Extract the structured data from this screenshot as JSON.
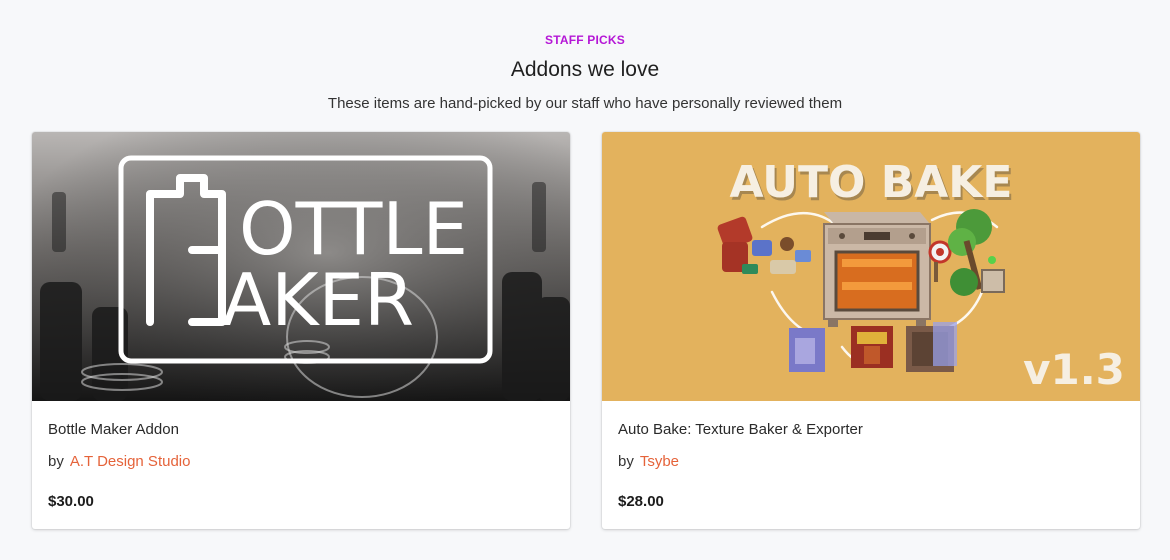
{
  "section": {
    "eyebrow": "STAFF PICKS",
    "title": "Addons we love",
    "subtitle": "These items are hand-picked by our staff who have personally reviewed them"
  },
  "colors": {
    "eyebrow": "#b517d6",
    "author_link": "#e5633a",
    "autobake_bg": "#e3b25d"
  },
  "cards": [
    {
      "name": "Bottle Maker Addon",
      "by_label": "by",
      "author": "A.T Design Studio",
      "price": "$30.00",
      "thumb_text_line1": "OTTLE",
      "thumb_text_line2": "AKER"
    },
    {
      "name": "Auto Bake: Texture Baker & Exporter",
      "by_label": "by",
      "author": "Tsybe",
      "price": "$28.00",
      "thumb_title": "AUTO BAKE",
      "thumb_version": "v1.3"
    }
  ]
}
